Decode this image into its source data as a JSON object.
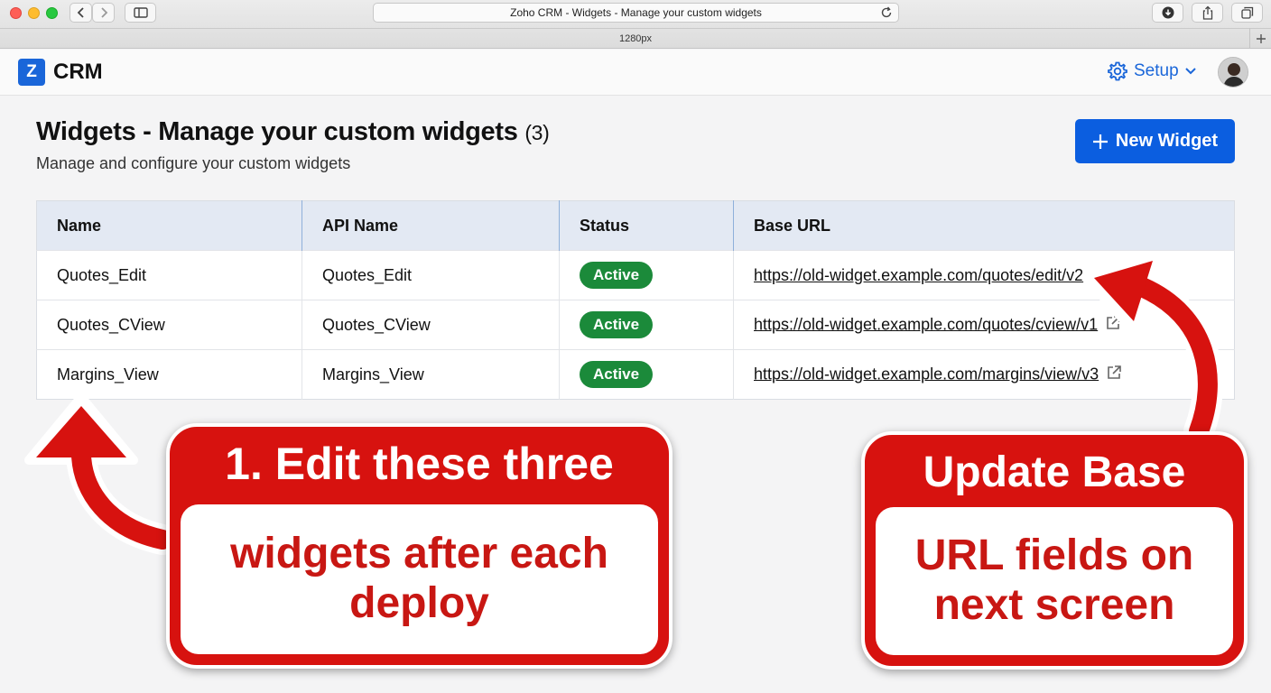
{
  "browser": {
    "tab_title": "Zoho CRM - Widgets - Manage your custom widgets",
    "viewport_label": "1280px"
  },
  "header": {
    "logo_letter": "Z",
    "logo_text": "CRM",
    "setup_label": "Setup"
  },
  "page": {
    "title": "Widgets - Manage your custom widgets",
    "count": "(3)",
    "subtitle": "Manage and configure your custom widgets",
    "new_button_label": "New Widget"
  },
  "table": {
    "columns": [
      "Name",
      "API Name",
      "Status",
      "Base URL"
    ],
    "rows": [
      {
        "name": "Quotes_Edit",
        "api_name": "Quotes_Edit",
        "status": "Active",
        "base_url": "https://old-widget.example.com/quotes/edit/v2"
      },
      {
        "name": "Quotes_CView",
        "api_name": "Quotes_CView",
        "status": "Active",
        "base_url": "https://old-widget.example.com/quotes/cview/v1"
      },
      {
        "name": "Margins_View",
        "api_name": "Margins_View",
        "status": "Active",
        "base_url": "https://old-widget.example.com/margins/view/v3"
      }
    ]
  },
  "callouts": {
    "left": {
      "head": "1. Edit these three",
      "body": "widgets after each deploy"
    },
    "right": {
      "head": "Update Base",
      "body": "URL fields on next screen"
    }
  },
  "colors": {
    "accent": "#0b5ee0",
    "status_active": "#1b8a3a",
    "callout_red": "#d7120f"
  },
  "icons": [
    "back-icon",
    "forward-icon",
    "sidebar-icon",
    "reload-icon",
    "download-icon",
    "share-icon",
    "tabs-icon",
    "gear-icon",
    "chevron-down-icon",
    "plus-icon",
    "external-link-icon"
  ]
}
